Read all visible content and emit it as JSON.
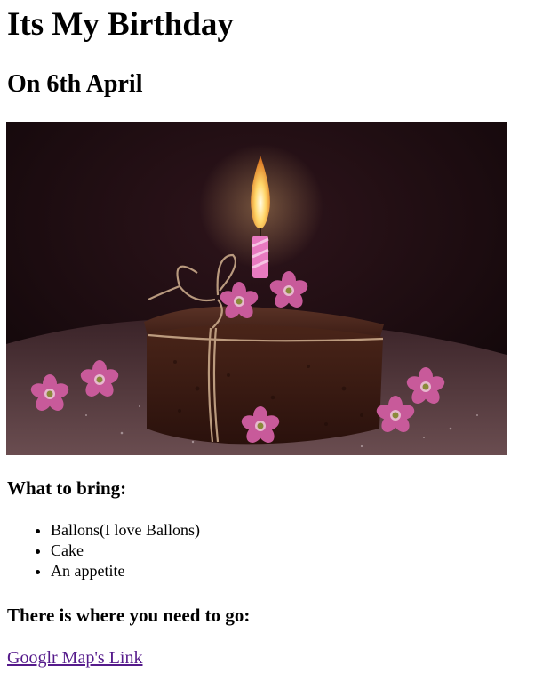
{
  "title": "Its My Birthday",
  "subtitle": "On 6th April",
  "image": {
    "alt": "birthday cake"
  },
  "bring": {
    "heading": "What to bring:",
    "items": [
      "Ballons(I love Ballons)",
      "Cake",
      "An appetite"
    ]
  },
  "directions": {
    "heading": "There is where you need to go:",
    "link_label": "Googlr Map's Link"
  },
  "colors": {
    "link_visited": "#551a8b",
    "photo_background": "#1c0c10",
    "cake": "#3b1c14",
    "flame": "#ffd76a",
    "candle": "#e87ac0",
    "flower": "#c85a9a"
  }
}
